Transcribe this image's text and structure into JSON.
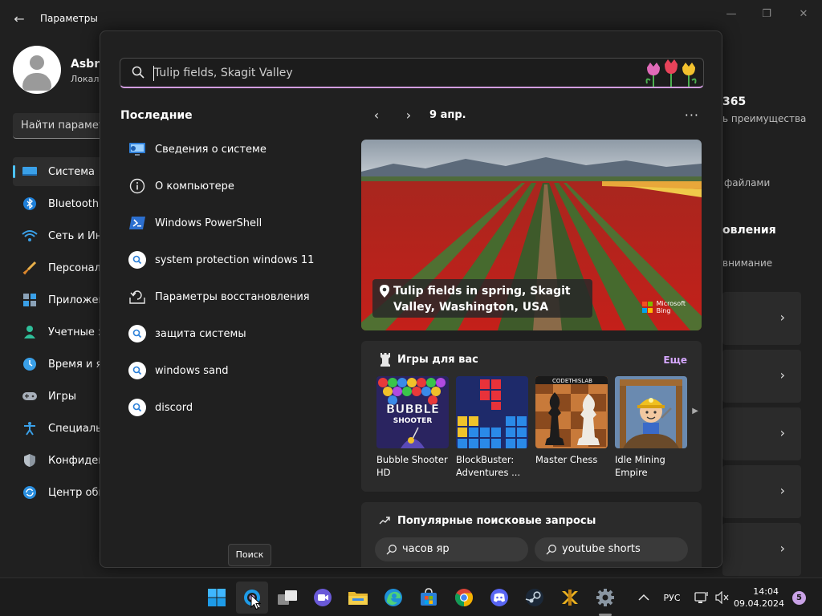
{
  "settings": {
    "title": "Параметры",
    "user_name": "Asbro",
    "user_sub": "Локал",
    "find_placeholder": "Найти парамет",
    "nav": [
      {
        "label": "Система",
        "icon": "system-icon"
      },
      {
        "label": "Bluetooth",
        "icon": "bluetooth-icon"
      },
      {
        "label": "Сеть и Инт",
        "icon": "wifi-icon"
      },
      {
        "label": "Персонал",
        "icon": "brush-icon"
      },
      {
        "label": "Приложен",
        "icon": "apps-icon"
      },
      {
        "label": "Учетные з",
        "icon": "account-icon"
      },
      {
        "label": "Время и я",
        "icon": "clock-icon"
      },
      {
        "label": "Игры",
        "icon": "gamepad-icon"
      },
      {
        "label": "Специаль",
        "icon": "accessibility-icon"
      },
      {
        "label": "Конфиден",
        "icon": "shield-icon"
      },
      {
        "label": "Центр обн",
        "icon": "update-icon"
      }
    ],
    "right_texts": [
      "365",
      "ь преимущества",
      "файлами",
      "овления",
      "внимание"
    ]
  },
  "search": {
    "query": "Tulip fields, Skagit Valley",
    "recent_title": "Последние",
    "recent": [
      {
        "label": "Сведения о системе",
        "icon": "system-info-icon"
      },
      {
        "label": "О компьютере",
        "icon": "info-icon"
      },
      {
        "label": "Windows PowerShell",
        "icon": "powershell-icon"
      },
      {
        "label": "system protection windows 11",
        "icon": "search-icon"
      },
      {
        "label": "Параметры восстановления",
        "icon": "recovery-icon"
      },
      {
        "label": "защита системы",
        "icon": "search-icon"
      },
      {
        "label": "windows sand",
        "icon": "search-icon"
      },
      {
        "label": "discord",
        "icon": "search-icon"
      }
    ],
    "date": "9 апр.",
    "hero_caption": "Tulip fields in spring, Skagit Valley, Washington, USA",
    "bing_line1": "Microsoft",
    "bing_line2": "Bing",
    "games_title": "Игры для вас",
    "games_more": "Еще",
    "games": [
      {
        "name": "Bubble Shooter HD"
      },
      {
        "name": "BlockBuster: Adventures ..."
      },
      {
        "name": "Master Chess"
      },
      {
        "name": "Idle Mining Empire"
      }
    ],
    "bubble_title": "BUBBLE",
    "bubble_sub": "SHOOTER",
    "chess_label": "CODETHISLAB",
    "popular_title": "Популярные поисковые запросы",
    "popular": [
      "часов яр",
      "youtube shorts"
    ],
    "tooltip": "Поиск"
  },
  "taskbar": {
    "lang": "РУС",
    "time": "14:04",
    "date": "09.04.2024",
    "notifications": "5"
  },
  "colors": {
    "accent": "#4cc2ff",
    "search_underline": "#d29de0",
    "link": "#d6a8ff"
  }
}
